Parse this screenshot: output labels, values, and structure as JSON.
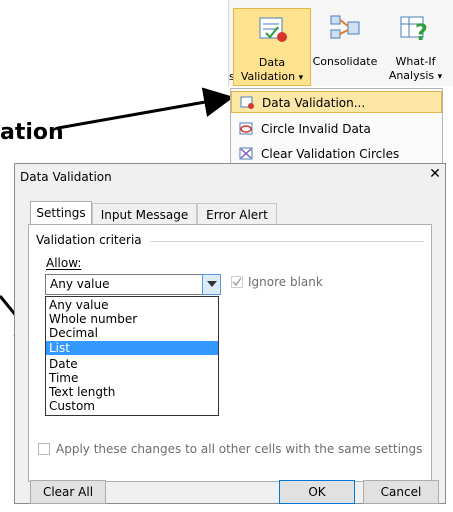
{
  "annotation": {
    "text": "ation"
  },
  "ribbon": {
    "data_validation": {
      "line1": "Data",
      "line2": "Validation",
      "arrow": "▾"
    },
    "consolidate": {
      "label": "Consolidate"
    },
    "what_if": {
      "line1": "What-If",
      "line2": "Analysis",
      "arrow": "▾"
    },
    "left_fragment": "s"
  },
  "dropdown_menu": {
    "items": [
      {
        "label": "Data Validation..."
      },
      {
        "label": "Circle Invalid Data"
      },
      {
        "label": "Clear Validation Circles"
      }
    ]
  },
  "dialog": {
    "title": "Data Validation",
    "close_label": "✕",
    "tabs": [
      {
        "label": "Settings"
      },
      {
        "label": "Input Message"
      },
      {
        "label": "Error Alert"
      }
    ],
    "section_title": "Validation criteria",
    "allow_label": "Allow:",
    "allow_value": "Any value",
    "ignore_blank_label": "Ignore blank",
    "allow_options": [
      "Any value",
      "Whole number",
      "Decimal",
      "List",
      "Date",
      "Time",
      "Text length",
      "Custom"
    ],
    "apply_label": "Apply these changes to all other cells with the same settings",
    "buttons": {
      "clear_all": "Clear All",
      "ok": "OK",
      "cancel": "Cancel"
    }
  },
  "colors": {
    "highlight": "#fde7a6",
    "selection": "#3399ff",
    "arrow": "#000000"
  }
}
